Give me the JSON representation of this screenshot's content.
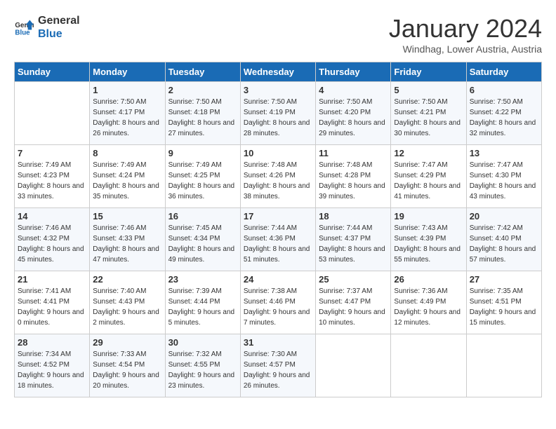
{
  "header": {
    "logo_line1": "General",
    "logo_line2": "Blue",
    "title": "January 2024",
    "subtitle": "Windhag, Lower Austria, Austria"
  },
  "weekdays": [
    "Sunday",
    "Monday",
    "Tuesday",
    "Wednesday",
    "Thursday",
    "Friday",
    "Saturday"
  ],
  "weeks": [
    [
      {
        "day": "",
        "sunrise": "",
        "sunset": "",
        "daylight": ""
      },
      {
        "day": "1",
        "sunrise": "Sunrise: 7:50 AM",
        "sunset": "Sunset: 4:17 PM",
        "daylight": "Daylight: 8 hours and 26 minutes."
      },
      {
        "day": "2",
        "sunrise": "Sunrise: 7:50 AM",
        "sunset": "Sunset: 4:18 PM",
        "daylight": "Daylight: 8 hours and 27 minutes."
      },
      {
        "day": "3",
        "sunrise": "Sunrise: 7:50 AM",
        "sunset": "Sunset: 4:19 PM",
        "daylight": "Daylight: 8 hours and 28 minutes."
      },
      {
        "day": "4",
        "sunrise": "Sunrise: 7:50 AM",
        "sunset": "Sunset: 4:20 PM",
        "daylight": "Daylight: 8 hours and 29 minutes."
      },
      {
        "day": "5",
        "sunrise": "Sunrise: 7:50 AM",
        "sunset": "Sunset: 4:21 PM",
        "daylight": "Daylight: 8 hours and 30 minutes."
      },
      {
        "day": "6",
        "sunrise": "Sunrise: 7:50 AM",
        "sunset": "Sunset: 4:22 PM",
        "daylight": "Daylight: 8 hours and 32 minutes."
      }
    ],
    [
      {
        "day": "7",
        "sunrise": "Sunrise: 7:49 AM",
        "sunset": "Sunset: 4:23 PM",
        "daylight": "Daylight: 8 hours and 33 minutes."
      },
      {
        "day": "8",
        "sunrise": "Sunrise: 7:49 AM",
        "sunset": "Sunset: 4:24 PM",
        "daylight": "Daylight: 8 hours and 35 minutes."
      },
      {
        "day": "9",
        "sunrise": "Sunrise: 7:49 AM",
        "sunset": "Sunset: 4:25 PM",
        "daylight": "Daylight: 8 hours and 36 minutes."
      },
      {
        "day": "10",
        "sunrise": "Sunrise: 7:48 AM",
        "sunset": "Sunset: 4:26 PM",
        "daylight": "Daylight: 8 hours and 38 minutes."
      },
      {
        "day": "11",
        "sunrise": "Sunrise: 7:48 AM",
        "sunset": "Sunset: 4:28 PM",
        "daylight": "Daylight: 8 hours and 39 minutes."
      },
      {
        "day": "12",
        "sunrise": "Sunrise: 7:47 AM",
        "sunset": "Sunset: 4:29 PM",
        "daylight": "Daylight: 8 hours and 41 minutes."
      },
      {
        "day": "13",
        "sunrise": "Sunrise: 7:47 AM",
        "sunset": "Sunset: 4:30 PM",
        "daylight": "Daylight: 8 hours and 43 minutes."
      }
    ],
    [
      {
        "day": "14",
        "sunrise": "Sunrise: 7:46 AM",
        "sunset": "Sunset: 4:32 PM",
        "daylight": "Daylight: 8 hours and 45 minutes."
      },
      {
        "day": "15",
        "sunrise": "Sunrise: 7:46 AM",
        "sunset": "Sunset: 4:33 PM",
        "daylight": "Daylight: 8 hours and 47 minutes."
      },
      {
        "day": "16",
        "sunrise": "Sunrise: 7:45 AM",
        "sunset": "Sunset: 4:34 PM",
        "daylight": "Daylight: 8 hours and 49 minutes."
      },
      {
        "day": "17",
        "sunrise": "Sunrise: 7:44 AM",
        "sunset": "Sunset: 4:36 PM",
        "daylight": "Daylight: 8 hours and 51 minutes."
      },
      {
        "day": "18",
        "sunrise": "Sunrise: 7:44 AM",
        "sunset": "Sunset: 4:37 PM",
        "daylight": "Daylight: 8 hours and 53 minutes."
      },
      {
        "day": "19",
        "sunrise": "Sunrise: 7:43 AM",
        "sunset": "Sunset: 4:39 PM",
        "daylight": "Daylight: 8 hours and 55 minutes."
      },
      {
        "day": "20",
        "sunrise": "Sunrise: 7:42 AM",
        "sunset": "Sunset: 4:40 PM",
        "daylight": "Daylight: 8 hours and 57 minutes."
      }
    ],
    [
      {
        "day": "21",
        "sunrise": "Sunrise: 7:41 AM",
        "sunset": "Sunset: 4:41 PM",
        "daylight": "Daylight: 9 hours and 0 minutes."
      },
      {
        "day": "22",
        "sunrise": "Sunrise: 7:40 AM",
        "sunset": "Sunset: 4:43 PM",
        "daylight": "Daylight: 9 hours and 2 minutes."
      },
      {
        "day": "23",
        "sunrise": "Sunrise: 7:39 AM",
        "sunset": "Sunset: 4:44 PM",
        "daylight": "Daylight: 9 hours and 5 minutes."
      },
      {
        "day": "24",
        "sunrise": "Sunrise: 7:38 AM",
        "sunset": "Sunset: 4:46 PM",
        "daylight": "Daylight: 9 hours and 7 minutes."
      },
      {
        "day": "25",
        "sunrise": "Sunrise: 7:37 AM",
        "sunset": "Sunset: 4:47 PM",
        "daylight": "Daylight: 9 hours and 10 minutes."
      },
      {
        "day": "26",
        "sunrise": "Sunrise: 7:36 AM",
        "sunset": "Sunset: 4:49 PM",
        "daylight": "Daylight: 9 hours and 12 minutes."
      },
      {
        "day": "27",
        "sunrise": "Sunrise: 7:35 AM",
        "sunset": "Sunset: 4:51 PM",
        "daylight": "Daylight: 9 hours and 15 minutes."
      }
    ],
    [
      {
        "day": "28",
        "sunrise": "Sunrise: 7:34 AM",
        "sunset": "Sunset: 4:52 PM",
        "daylight": "Daylight: 9 hours and 18 minutes."
      },
      {
        "day": "29",
        "sunrise": "Sunrise: 7:33 AM",
        "sunset": "Sunset: 4:54 PM",
        "daylight": "Daylight: 9 hours and 20 minutes."
      },
      {
        "day": "30",
        "sunrise": "Sunrise: 7:32 AM",
        "sunset": "Sunset: 4:55 PM",
        "daylight": "Daylight: 9 hours and 23 minutes."
      },
      {
        "day": "31",
        "sunrise": "Sunrise: 7:30 AM",
        "sunset": "Sunset: 4:57 PM",
        "daylight": "Daylight: 9 hours and 26 minutes."
      },
      {
        "day": "",
        "sunrise": "",
        "sunset": "",
        "daylight": ""
      },
      {
        "day": "",
        "sunrise": "",
        "sunset": "",
        "daylight": ""
      },
      {
        "day": "",
        "sunrise": "",
        "sunset": "",
        "daylight": ""
      }
    ]
  ]
}
